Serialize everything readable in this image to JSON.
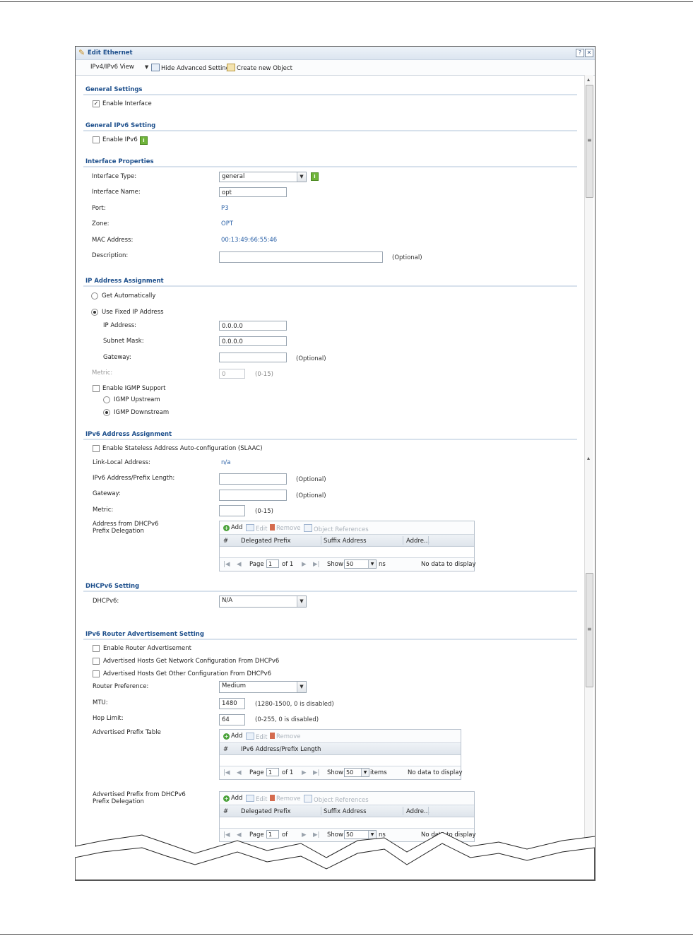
{
  "dialog": {
    "title": "Edit Ethernet",
    "help_label": "?",
    "close_label": "✕"
  },
  "toolbar": {
    "view_label": "IPv4/IPv6 View",
    "hide_advanced_label": "Hide Advanced Settings",
    "create_object_label": "Create new Object"
  },
  "general": {
    "section": "General Settings",
    "enable_interface_label": "Enable Interface",
    "enable_interface_checked": true
  },
  "general_ipv6": {
    "section": "General IPv6 Setting",
    "enable_ipv6_label": "Enable IPv6",
    "enable_ipv6_checked": false
  },
  "interface": {
    "section": "Interface Properties",
    "type_label": "Interface Type:",
    "type_value": "general",
    "name_label": "Interface Name:",
    "name_value": "opt",
    "port_label": "Port:",
    "port_value": "P3",
    "zone_label": "Zone:",
    "zone_value": "OPT",
    "mac_label": "MAC Address:",
    "mac_value": "00:13:49:66:55:46",
    "desc_label": "Description:",
    "desc_value": "",
    "optional": "(Optional)"
  },
  "ip": {
    "section": "IP Address Assignment",
    "get_auto_label": "Get Automatically",
    "use_fixed_label": "Use Fixed IP Address",
    "selected": "fixed",
    "ip_label": "IP Address:",
    "ip_value": "0.0.0.0",
    "mask_label": "Subnet Mask:",
    "mask_value": "0.0.0.0",
    "gateway_label": "Gateway:",
    "gateway_value": "",
    "gateway_hint": "(Optional)",
    "metric_label": "Metric:",
    "metric_value": "0",
    "metric_hint": "(0-15)",
    "igmp_label": "Enable IGMP Support",
    "igmp_up_label": "IGMP Upstream",
    "igmp_down_label": "IGMP Downstream"
  },
  "ipv6": {
    "section": "IPv6 Address Assignment",
    "slaac_label": "Enable Stateless Address Auto-configuration (SLAAC)",
    "link_local_label": "Link-Local Address:",
    "link_local_value": "n/a",
    "prefix_label": "IPv6 Address/Prefix Length:",
    "prefix_hint": "(Optional)",
    "gateway_label": "Gateway:",
    "gateway_hint": "(Optional)",
    "metric_label": "Metric:",
    "metric_hint": "(0-15)",
    "delegation_label": "Address from DHCPv6 Prefix Delegation"
  },
  "grid1": {
    "add": "Add",
    "edit": "Edit",
    "remove": "Remove",
    "refs": "Object References",
    "cols": [
      "#",
      "Delegated Prefix",
      "Suffix Address",
      "Addre..."
    ],
    "page_label": "Page",
    "page_value": "1",
    "of_label": "of 1",
    "show_label": "Show",
    "show_value": "50",
    "items_label": "ns",
    "nodata": "No data to display"
  },
  "dhcpv6": {
    "section": "DHCPv6 Setting",
    "label": "DHCPv6:",
    "value": "N/A"
  },
  "ra": {
    "section": "IPv6 Router Advertisement Setting",
    "enable_label": "Enable Router Advertisement",
    "net_config_label": "Advertised Hosts Get Network Configuration From DHCPv6",
    "other_config_label": "Advertised Hosts Get Other Configuration From DHCPv6",
    "pref_label": "Router Preference:",
    "pref_value": "Medium",
    "mtu_label": "MTU:",
    "mtu_value": "1480",
    "mtu_hint": "(1280-1500, 0 is disabled)",
    "hop_label": "Hop Limit:",
    "hop_value": "64",
    "hop_hint": "(0-255, 0 is disabled)",
    "prefix_table_label": "Advertised Prefix Table",
    "prefix_delegation_label": "Advertised Prefix from DHCPv6 Prefix Delegation"
  },
  "grid2": {
    "add": "Add",
    "edit": "Edit",
    "remove": "Remove",
    "cols": [
      "#",
      "IPv6 Address/Prefix Length"
    ],
    "page_label": "Page",
    "page_value": "1",
    "of_label": "of 1",
    "show_label": "Show",
    "show_value": "50",
    "items_label": "items",
    "nodata": "No data to display"
  },
  "grid3": {
    "add": "Add",
    "edit": "Edit",
    "remove": "Remove",
    "refs": "Object References",
    "cols": [
      "#",
      "Delegated Prefix",
      "Suffix Address",
      "Addre..."
    ],
    "page_label": "Page",
    "page_value": "1",
    "of_label": "of",
    "show_label": "Show",
    "show_value": "50",
    "items_label": "ns",
    "nodata": "No data to display"
  },
  "icons": {
    "edit_dialog": "pencil-icon",
    "info": "info-icon",
    "add": "add-icon",
    "remove": "trash-icon",
    "references": "object-references-icon"
  }
}
